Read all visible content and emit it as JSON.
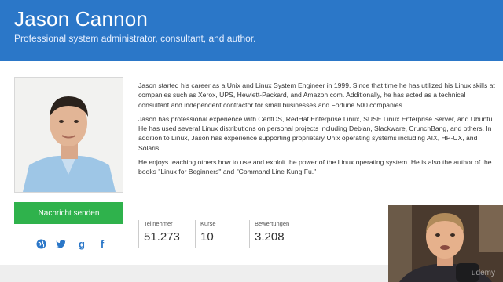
{
  "header": {
    "name": "Jason Cannon",
    "tagline": "Professional system administrator, consultant, and author."
  },
  "profile": {
    "photo_icon": "instructor-photo",
    "message_button_label": "Nachricht senden"
  },
  "social": [
    {
      "icon": "globe-icon",
      "glyph": "🌐"
    },
    {
      "icon": "twitter-icon",
      "glyph": "🐦"
    },
    {
      "icon": "google-plus-icon",
      "glyph": "g"
    },
    {
      "icon": "facebook-icon",
      "glyph": "f"
    }
  ],
  "bio": {
    "paragraphs": [
      "Jason started his career as a Unix and Linux System Engineer in 1999. Since that time he has utilized his Linux skills at companies such as Xerox, UPS, Hewlett-Packard, and Amazon.com. Additionally, he has acted as a technical consultant and independent contractor for small businesses and Fortune 500 companies.",
      "Jason has professional experience with CentOS, RedHat Enterprise Linux, SUSE Linux Enterprise Server, and Ubuntu. He has used several Linux distributions on personal projects including Debian, Slackware, CrunchBang, and others. In addition to Linux, Jason has experience supporting proprietary Unix operating systems including AIX, HP-UX, and Solaris.",
      "He enjoys teaching others how to use and exploit the power of the Linux operating system. He is also the author of the books \"Linux for Beginners\" and \"Command Line Kung Fu.\""
    ]
  },
  "stats": [
    {
      "label": "Teilnehmer",
      "value": "51.273"
    },
    {
      "label": "Kurse",
      "value": "10"
    },
    {
      "label": "Bewertungen",
      "value": "3.208"
    }
  ],
  "webcam": {
    "watermark": "udemy"
  },
  "colors": {
    "header_bg": "#2b77c8",
    "button_bg": "#2fb24c",
    "social_icon": "#2b77c8"
  }
}
